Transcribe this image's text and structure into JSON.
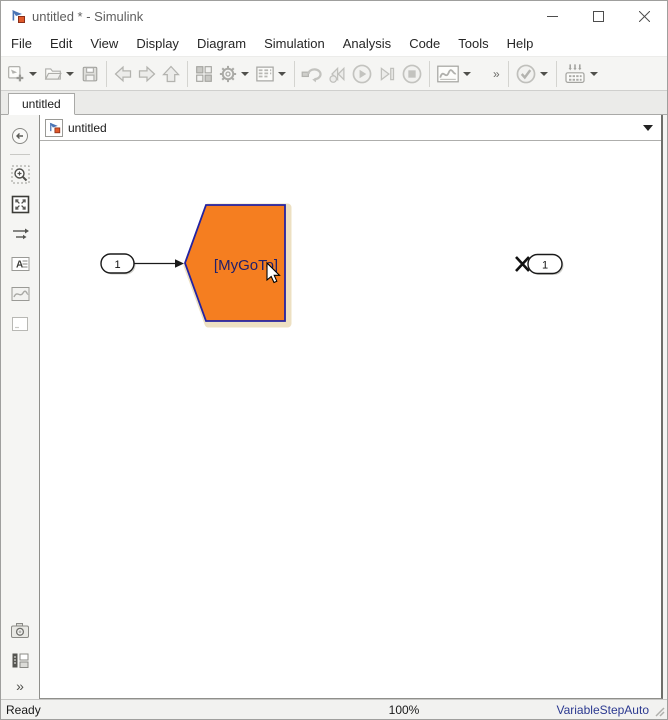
{
  "window": {
    "title": "untitled * - Simulink",
    "controls": [
      "minimize",
      "maximize",
      "close"
    ]
  },
  "menu": {
    "items": [
      "File",
      "Edit",
      "View",
      "Display",
      "Diagram",
      "Simulation",
      "Analysis",
      "Code",
      "Tools",
      "Help"
    ]
  },
  "toolbar": {
    "overflow_chevron": "»",
    "icons": [
      "new-model",
      "open",
      "save",
      "back",
      "forward",
      "up",
      "library-browser",
      "model-settings-gear",
      "model-configuration",
      "fast-restart",
      "step-back",
      "run",
      "step-forward",
      "stop",
      "simulation-data-inspector",
      "model-advisor-check",
      "update-diagram"
    ]
  },
  "tabbar": {
    "active_tab": "untitled"
  },
  "breadcrumb": {
    "model_name": "untitled"
  },
  "sidebar": {
    "expand_chevron": "»",
    "icons": [
      "hide-browser",
      "zoom-region",
      "fit-to-view",
      "signal-routing-arrows",
      "annotation",
      "image",
      "viewer-box",
      "screenshot-camera",
      "model-browser",
      "expand"
    ]
  },
  "canvas": {
    "inport": {
      "label": "1"
    },
    "goto_block": {
      "label": "[MyGoTo]"
    },
    "outport": {
      "label": "1"
    }
  },
  "statusbar": {
    "status": "Ready",
    "zoom": "100%",
    "solver": "VariableStepAuto"
  },
  "colors": {
    "goto_fill": "#F57E20",
    "goto_border": "#2323A2",
    "goto_glow": "#EDE0C2",
    "solver_text": "#2B3990",
    "toolbar_bg": "#F5F5F3"
  }
}
